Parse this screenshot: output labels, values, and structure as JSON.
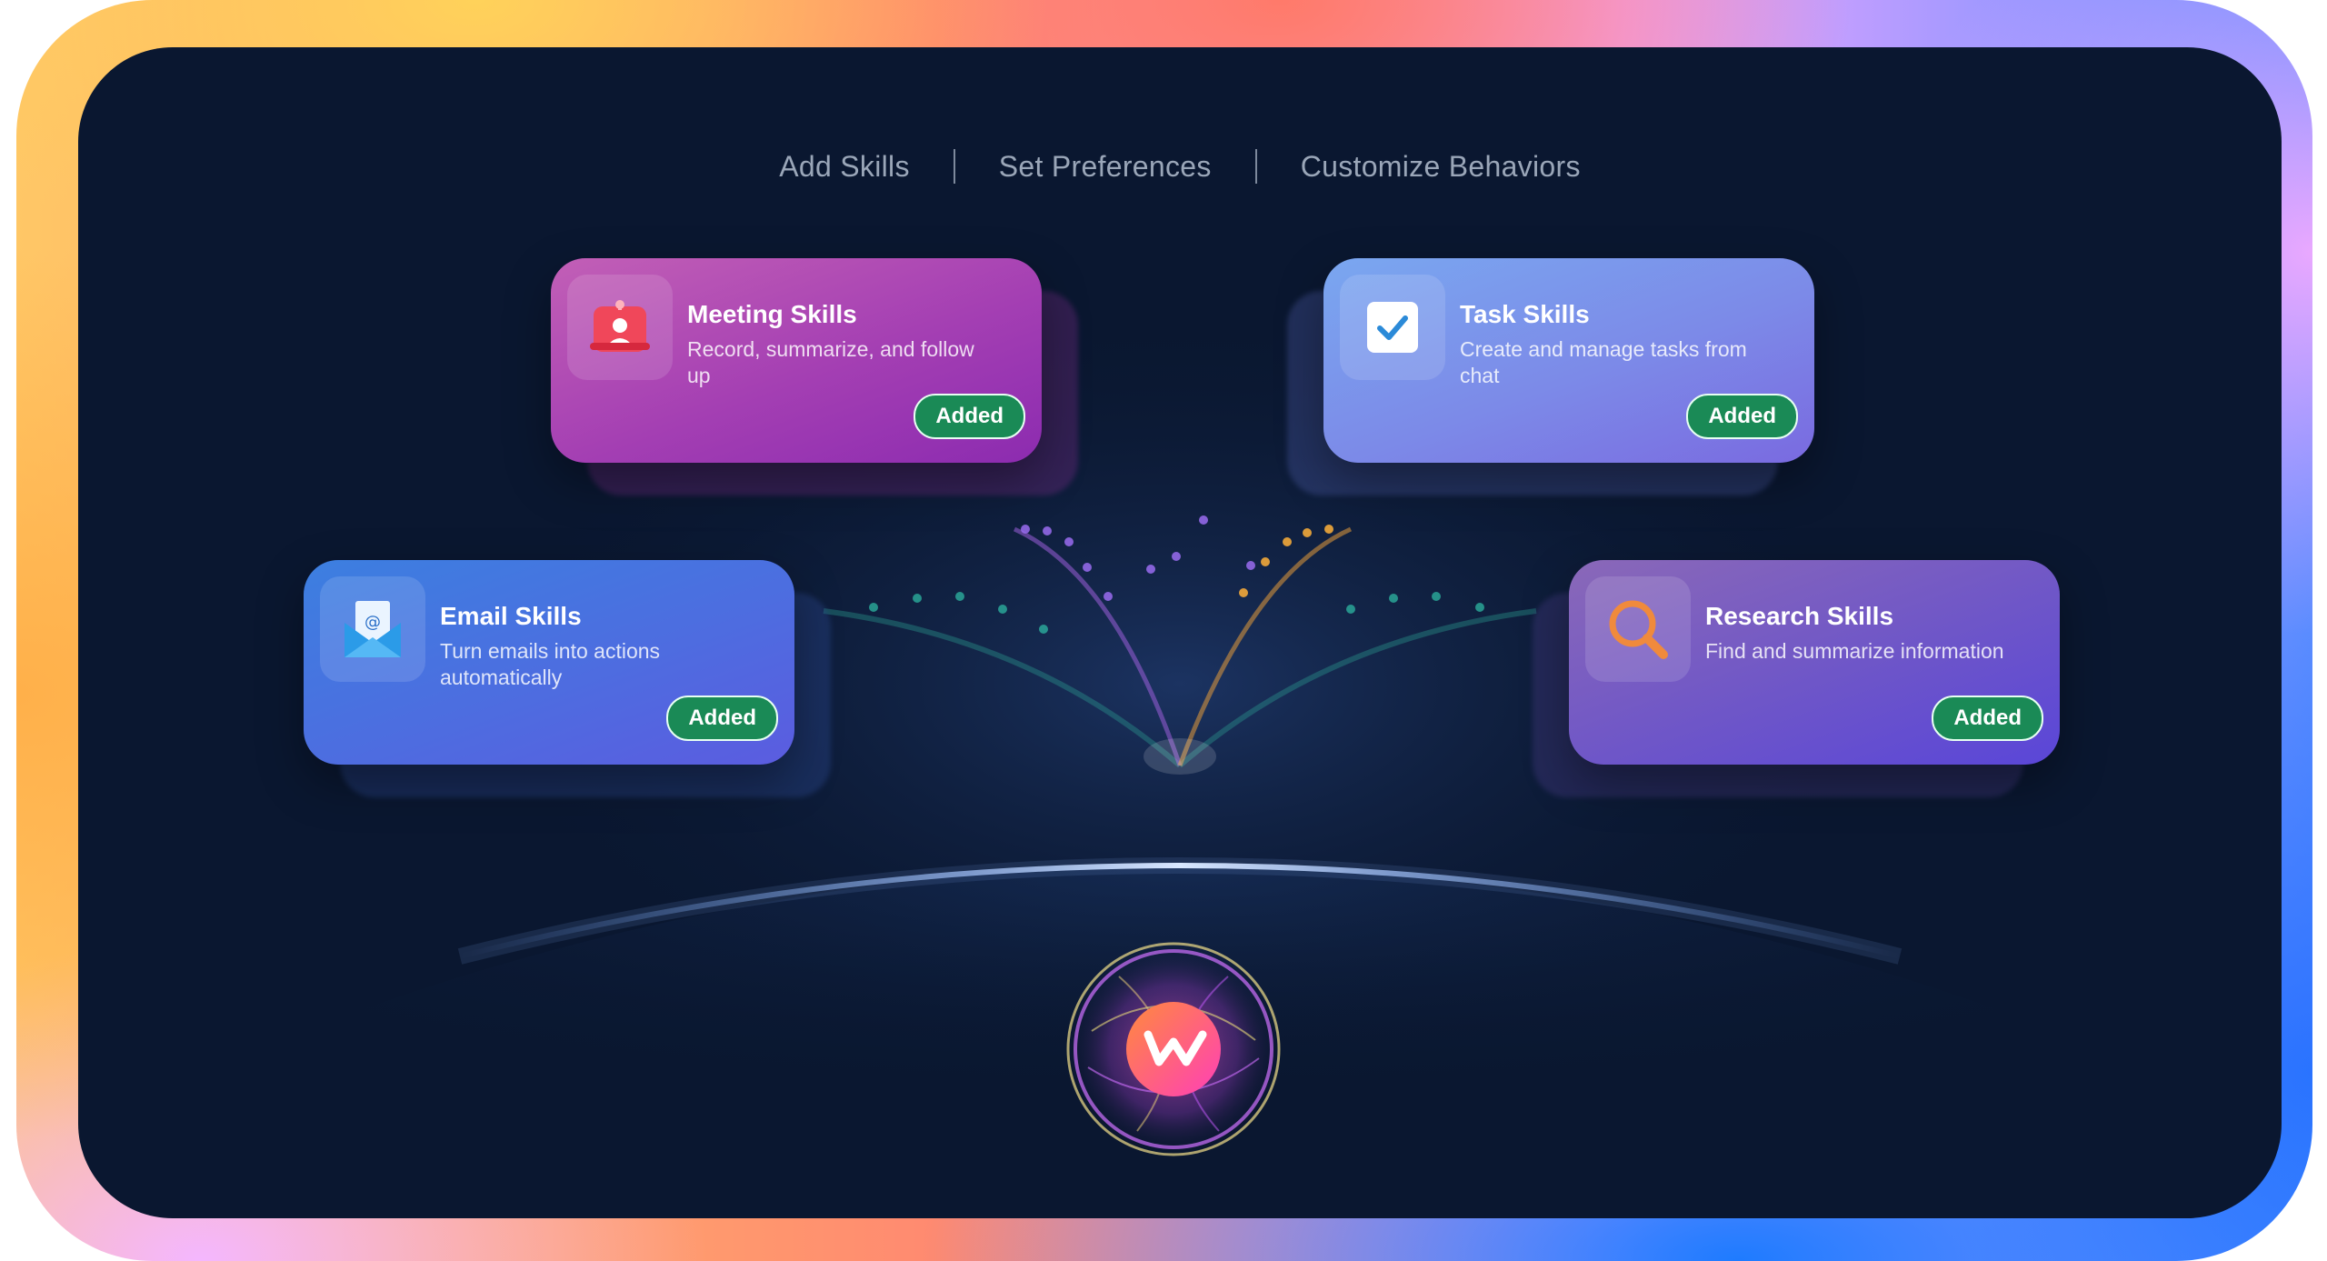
{
  "nav": {
    "items": [
      "Add Skills",
      "Set Preferences",
      "Customize Behaviors"
    ]
  },
  "cards": {
    "meeting": {
      "title": "Meeting Skills",
      "description": "Record, summarize, and follow up",
      "status": "Added",
      "icon": "meeting-badge-icon",
      "color": "#a43fb3"
    },
    "task": {
      "title": "Task Skills",
      "description": "Create and manage tasks from chat",
      "status": "Added",
      "icon": "checkbox-icon",
      "color": "#7c8ae8"
    },
    "email": {
      "title": "Email Skills",
      "description": "Turn emails into actions automatically",
      "status": "Added",
      "icon": "email-envelope-icon",
      "color": "#4d6de0"
    },
    "research": {
      "title": "Research Skills",
      "description": "Find and summarize information",
      "status": "Added",
      "icon": "magnifier-icon",
      "color": "#6e56c8"
    }
  },
  "colors": {
    "background": "#0a1730",
    "added_badge": "#1a8a56",
    "nav_text": "#9aa6b8"
  },
  "logo": {
    "icon": "orb-logo-icon"
  }
}
